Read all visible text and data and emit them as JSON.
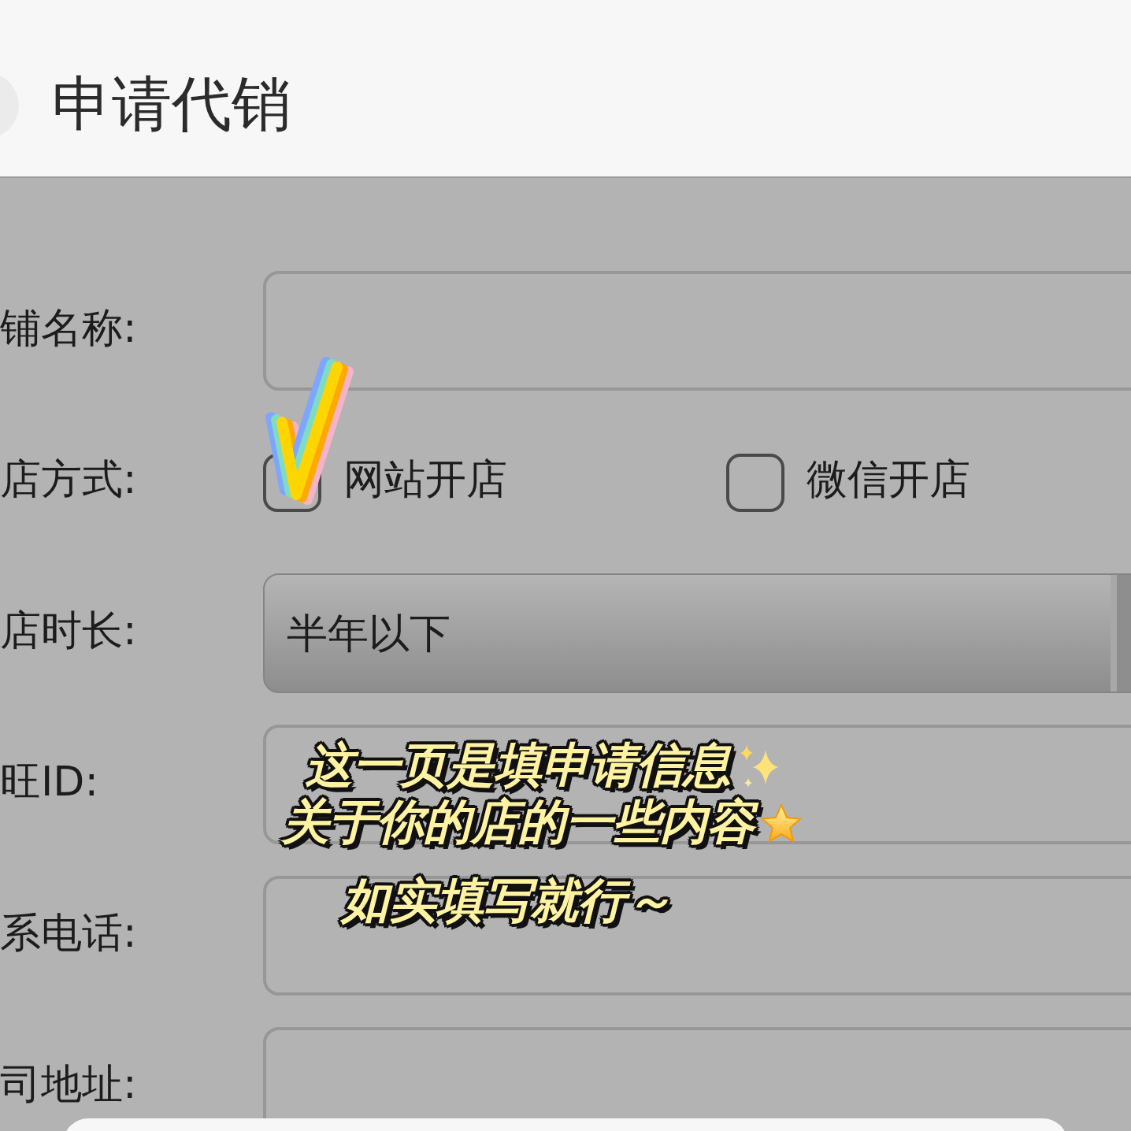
{
  "header": {
    "title": "申请代销"
  },
  "form": {
    "rows": [
      {
        "kind": "text",
        "label": "铺名称:"
      },
      {
        "kind": "checkboxes",
        "label": "店方式:",
        "options": [
          {
            "label": "网站开店",
            "checked": true
          },
          {
            "label": "微信开店",
            "checked": false
          }
        ]
      },
      {
        "kind": "dropdown",
        "label": "店时长:",
        "value": "半年以下"
      },
      {
        "kind": "text",
        "label": "旺ID:"
      },
      {
        "kind": "text",
        "label": "系电话:"
      },
      {
        "kind": "text",
        "label": "司地址:"
      }
    ]
  },
  "notes": [
    {
      "text": "这一页是填申请信息",
      "kind": "sparkle"
    },
    {
      "text": "关于你的店的一些内容",
      "kind": "star"
    },
    {
      "text": "如实填写就行～",
      "kind": "plain"
    }
  ]
}
